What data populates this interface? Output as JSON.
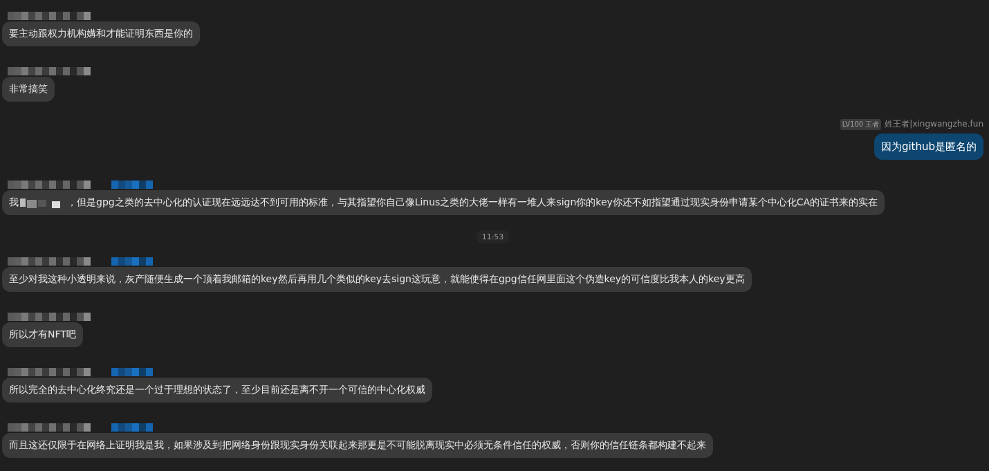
{
  "messages": [
    {
      "kind": "received",
      "tagged": false,
      "text": "要主动跟权力机构媾和才能证明东西是你的"
    },
    {
      "kind": "received",
      "tagged": false,
      "text": "非常搞笑"
    },
    {
      "kind": "sent",
      "level_badge": "LV100 王者",
      "sender": "姓王者|xingwangzhe.fun",
      "text": "因为github是匿名的"
    },
    {
      "kind": "received",
      "tagged": true,
      "redacted_prefix": "我",
      "text": "，但是gpg之类的去中心化的认证现在远远达不到可用的标准，与其指望你自己像Linus之类的大佬一样有一堆人来sign你的key你还不如指望通过现实身份申请某个中心化CA的证书来的实在"
    },
    {
      "kind": "time",
      "text": "11:53"
    },
    {
      "kind": "received",
      "tagged": true,
      "text": "至少对我这种小透明来说，灰产随便生成一个顶着我邮箱的key然后再用几个类似的key去sign这玩意，就能使得在gpg信任网里面这个伪造key的可信度比我本人的key更高"
    },
    {
      "kind": "received",
      "tagged": false,
      "text": "所以才有NFT吧"
    },
    {
      "kind": "received",
      "tagged": true,
      "text": "所以完全的去中心化终究还是一个过于理想的状态了，至少目前还是离不开一个可信的中心化权威"
    },
    {
      "kind": "received",
      "tagged": true,
      "text": "而且这还仅限于在网络上证明我是我，如果涉及到把网络身份跟现实身份关联起来那更是不可能脱离现实中必须无条件信任的权威，否则你的信任链条都构建不起来"
    }
  ]
}
